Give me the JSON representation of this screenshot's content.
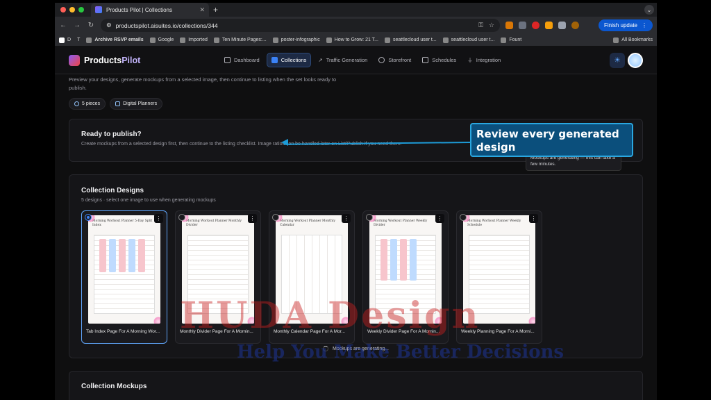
{
  "browser": {
    "tab_title": "Products Pilot | Collections",
    "url": "productspilot.aisuites.io/collections/344",
    "finish_update_label": "Finish update",
    "bookmarks": [
      "Archive RSVP emails",
      "Google",
      "Imported",
      "Ten Minute Pages:...",
      "poster-infographic",
      "How to Grow: 21 T...",
      "seattlecloud user t...",
      "seattlecloud user t...",
      "Fount"
    ],
    "all_bookmarks_label": "All Bookmarks"
  },
  "app": {
    "logo_text_a": "Products",
    "logo_text_b": "Pilot",
    "nav": [
      {
        "label": "Dashboard",
        "active": false
      },
      {
        "label": "Collections",
        "active": true
      },
      {
        "label": "Traffic Generation",
        "active": false
      },
      {
        "label": "Storefront",
        "active": false
      },
      {
        "label": "Schedules",
        "active": false
      },
      {
        "label": "Integration",
        "active": false
      }
    ]
  },
  "collection": {
    "intro": "Preview your designs, generate mockups from a selected image, then continue to listing when the set looks ready to publish.",
    "chips": [
      "5 pieces",
      "Digital Planners"
    ]
  },
  "publish": {
    "title": "Ready to publish?",
    "subtitle": "Create mockups from a selected design first, then continue to the listing checklist. Image ratios can be handled later on List/Publish if you need them.",
    "tooltip": "Mockups are generating — this can take a few minutes."
  },
  "designs": {
    "title": "Collection Designs",
    "subtitle": "5 designs · select one image to use when generating mockups",
    "items": [
      {
        "thumb_title": "Morning Workout Planner 5-Day Split Index",
        "label": "Tab Index Page For A Morning Wor...",
        "selected": true
      },
      {
        "thumb_title": "Morning Workout Planner Monthly Divider",
        "label": "Monthly Divider Page For A Mornin...",
        "selected": false
      },
      {
        "thumb_title": "Morning Workout Planner Monthly Calendar",
        "label": "Monthly Calendar Page For A Mor...",
        "selected": false
      },
      {
        "thumb_title": "Morning Workout Planner Weekly Divider",
        "label": "Weekly Divider Page For A Mornin...",
        "selected": false
      },
      {
        "thumb_title": "Morning Workout Planner Weekly Schedule",
        "label": "Weekly Planning Page For A Morni...",
        "selected": false
      }
    ],
    "generating_label": "Mockups are generating..."
  },
  "mockups": {
    "title": "Collection Mockups"
  },
  "annotation": {
    "text": "Review every generated design"
  },
  "watermark": {
    "line1": "HUDA Design",
    "line2": "Help You Make Better Decisions"
  },
  "colors": {
    "accent": "#3b82f6",
    "annotation_bg": "#0b4f7c",
    "annotation_border": "#2aa7e0"
  }
}
